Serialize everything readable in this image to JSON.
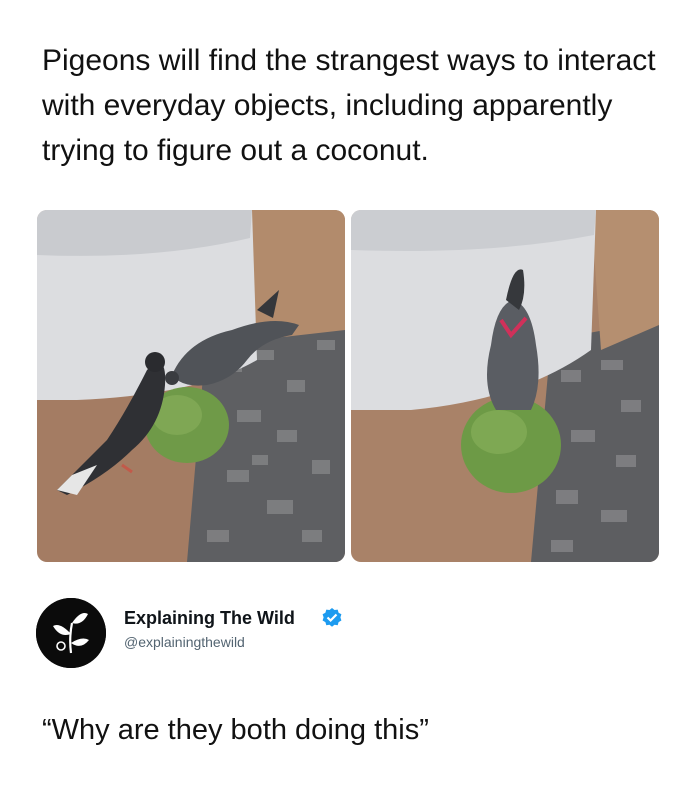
{
  "post": {
    "caption": "Pigeons will find the strangest ways to interact with everyday objects, including apparently trying to figure out a coconut.",
    "photos": [
      {
        "name": "left-photo",
        "subject": "two-pigeons-on-coconut"
      },
      {
        "name": "right-photo",
        "subject": "pigeon-perched-on-coconut"
      }
    ]
  },
  "tweet": {
    "author_name": "Explaining The Wild",
    "handle": "@explainingthewild",
    "verified": true,
    "avatar_icon": "leaf-sprout-icon",
    "text": "“Why are they both doing this”"
  },
  "colors": {
    "verified_badge": "#1d9bf0",
    "avatar_bg": "#0b0b0b"
  }
}
